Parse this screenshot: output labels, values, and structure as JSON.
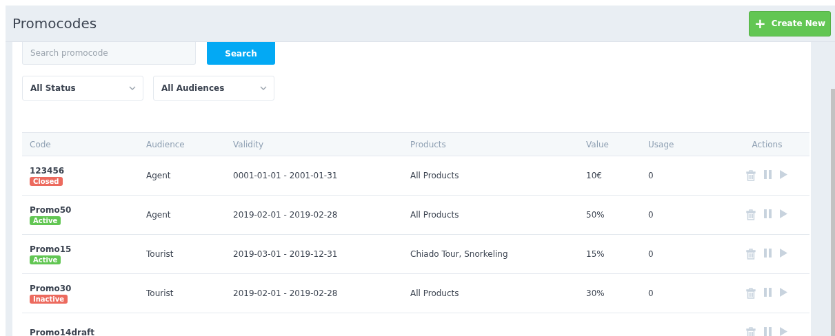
{
  "header": {
    "title": "Promocodes",
    "create_button": {
      "icon": "+",
      "label": "Create New"
    }
  },
  "search": {
    "placeholder": "Search promocode",
    "button": "Search"
  },
  "filters": [
    {
      "value": "All Status"
    },
    {
      "value": "All Audiences"
    }
  ],
  "table": {
    "columns": [
      "Code",
      "Audience",
      "Validity",
      "Products",
      "Value",
      "Usage",
      "Actions"
    ],
    "rows": [
      {
        "code": "123456",
        "status": {
          "label": "Closed",
          "color": "#ec6a5e"
        },
        "audience": "Agent",
        "validity": "0001-01-01 - 2001-01-31",
        "products": "All Products",
        "value": "10€",
        "usage": "0"
      },
      {
        "code": "Promo50",
        "status": {
          "label": "Active",
          "color": "#62c653"
        },
        "audience": "Agent",
        "validity": "2019-02-01 - 2019-02-28",
        "products": "All Products",
        "value": "50%",
        "usage": "0"
      },
      {
        "code": "Promo15",
        "status": {
          "label": "Active",
          "color": "#62c653"
        },
        "audience": "Tourist",
        "validity": "2019-03-01 - 2019-12-31",
        "products": "Chiado Tour, Snorkeling",
        "value": "15%",
        "usage": "0"
      },
      {
        "code": "Promo30",
        "status": {
          "label": "Inactive",
          "color": "#ec6a5e"
        },
        "audience": "Tourist",
        "validity": "2019-02-01 - 2019-02-28",
        "products": "All Products",
        "value": "30%",
        "usage": "0"
      },
      {
        "code": "Promo14draft"
      }
    ]
  }
}
